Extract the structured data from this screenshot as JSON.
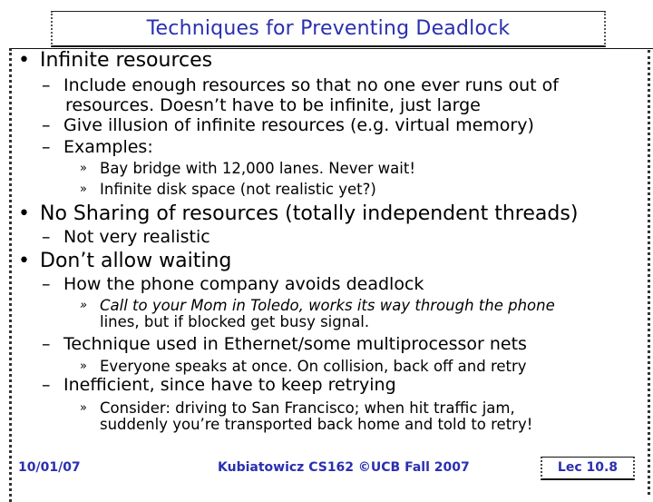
{
  "slide": {
    "title": "Techniques for Preventing Deadlock",
    "bullets": [
      {
        "text": "Infinite resources",
        "subs": [
          {
            "text": "Include enough resources so that no one ever runs out of",
            "cont": "resources. Doesn’t have to be infinite, just large"
          },
          {
            "text": "Give illusion of infinite resources (e.g. virtual memory)"
          },
          {
            "text": "Examples:",
            "subs": [
              {
                "text": "Bay bridge with 12,000 lanes.  Never wait!"
              },
              {
                "text": "Infinite disk space (not realistic yet?)"
              }
            ]
          }
        ]
      },
      {
        "text": "No Sharing of resources (totally independent threads)",
        "subs": [
          {
            "text": "Not very realistic"
          }
        ]
      },
      {
        "text": "Don’t allow waiting",
        "subs": [
          {
            "text": "How the phone company avoids deadlock",
            "subs": [
              {
                "text": "Call to your Mom in Toledo, works its way through the phone",
                "cont": "lines, but if blocked get busy signal."
              }
            ]
          },
          {
            "text": "Technique used in Ethernet/some multiprocessor nets",
            "subs": [
              {
                "text": "Everyone speaks at once.  On collision, back off and retry"
              }
            ]
          },
          {
            "text": "Inefficient, since have to keep retrying",
            "subs": [
              {
                "text": "Consider: driving to San Francisco; when hit traffic jam,",
                "cont": "suddenly you’re transported back home and told to retry!"
              }
            ]
          }
        ]
      }
    ]
  },
  "symbols": {
    "bullet": "•",
    "dash": "–",
    "sub_bullet": "»"
  },
  "footer": {
    "date": "10/01/07",
    "center": "Kubiatowicz CS162 ©UCB Fall 2007",
    "lecture": "Lec 10.8"
  },
  "colors": {
    "title": "#2a2fb0",
    "footer": "#2a2fb0",
    "text": "#000000"
  }
}
